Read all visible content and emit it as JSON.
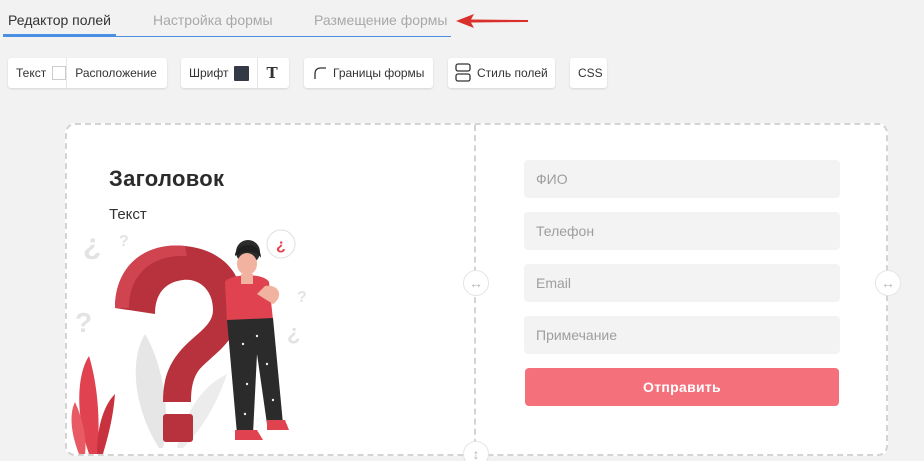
{
  "tabs": [
    {
      "label": "Редактор полей",
      "active": true
    },
    {
      "label": "Настройка формы",
      "active": false
    },
    {
      "label": "Размещение формы",
      "active": false
    }
  ],
  "toolbar": {
    "text_label": "Текст",
    "position_label": "Расположение",
    "font_label": "Шрифт",
    "font_color": "#333a45",
    "borders_label": "Границы формы",
    "field_style_label": "Стиль полей",
    "css_label": "CSS"
  },
  "form_preview": {
    "heading": "Заголовок",
    "text": "Текст",
    "fields": [
      {
        "placeholder": "ФИО"
      },
      {
        "placeholder": "Телефон"
      },
      {
        "placeholder": "Email"
      },
      {
        "placeholder": "Примечание"
      }
    ],
    "submit_label": "Отправить"
  },
  "colors": {
    "accent": "#4a90e2",
    "submit": "#f4717c",
    "annotation_arrow": "#d9302b"
  }
}
